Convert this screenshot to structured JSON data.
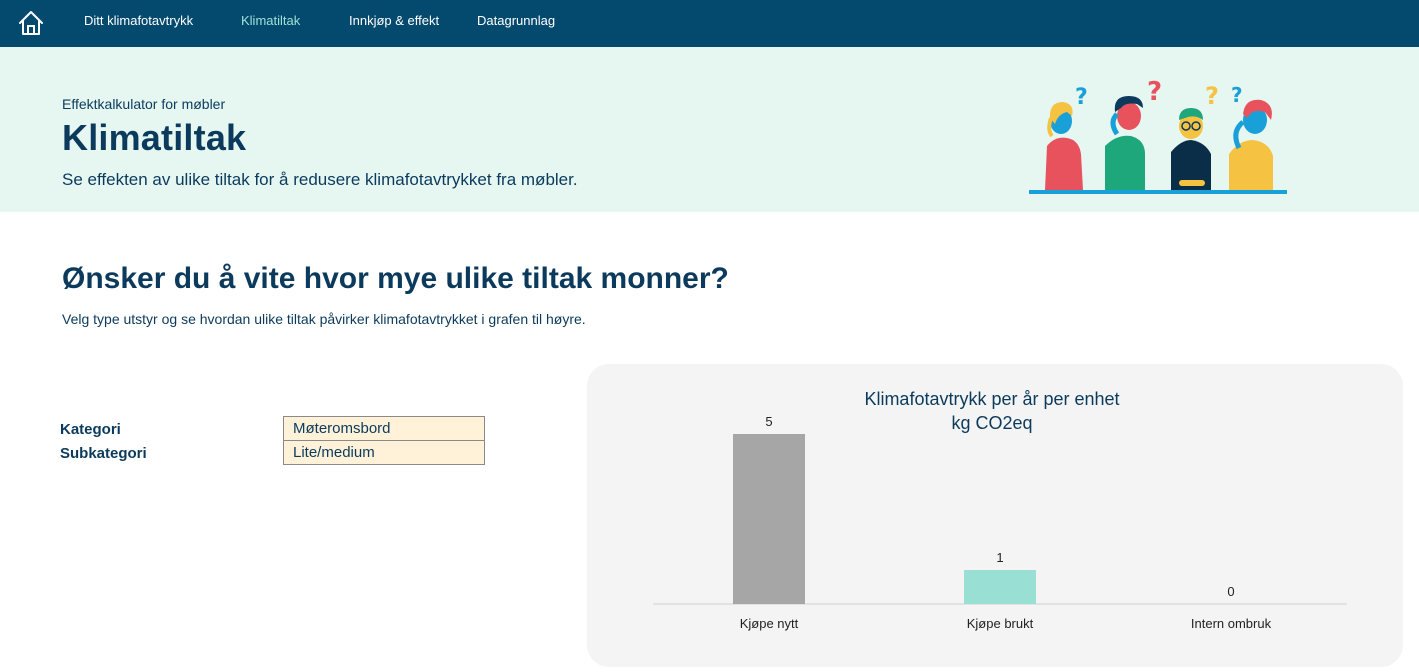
{
  "nav": {
    "home_icon": "home-icon",
    "items": [
      {
        "label": "Ditt klimafotavtrykk",
        "active": false
      },
      {
        "label": "Klimatiltak",
        "active": true
      },
      {
        "label": "Innkjøp & effekt",
        "active": false
      },
      {
        "label": "Datagrunnlag",
        "active": false
      }
    ]
  },
  "hero": {
    "subtitle": "Effektkalkulator for møbler",
    "title": "Klimatiltak",
    "description": "Se effekten av ulike tiltak for å redusere klimafotavtrykket fra møbler."
  },
  "main": {
    "heading": "Ønsker du å vite hvor mye ulike tiltak monner?",
    "paragraph": "Velg type utstyr og se hvordan ulike tiltak påvirker klimafotavtrykket i grafen til høyre."
  },
  "form": {
    "category_label": "Kategori",
    "category_value": "Møteromsbord",
    "subcategory_label": "Subkategori",
    "subcategory_value": "Lite/medium"
  },
  "colors": {
    "nav_bg": "#034a6e",
    "hero_bg": "#e6f7f2",
    "text": "#0b3a5c",
    "input_bg": "#fff2d9"
  },
  "chart_data": {
    "type": "bar",
    "title": "Klimafotavtrykk per år per enhet",
    "subtitle": "kg CO2eq",
    "categories": [
      "Kjøpe nytt",
      "Kjøpe brukt",
      "Intern ombruk"
    ],
    "values": [
      5,
      1,
      0
    ],
    "bar_colors": [
      "#a6a6a6",
      "#9adfd3",
      "#9adfd3"
    ],
    "ylim": [
      0,
      5
    ],
    "grid": false
  }
}
